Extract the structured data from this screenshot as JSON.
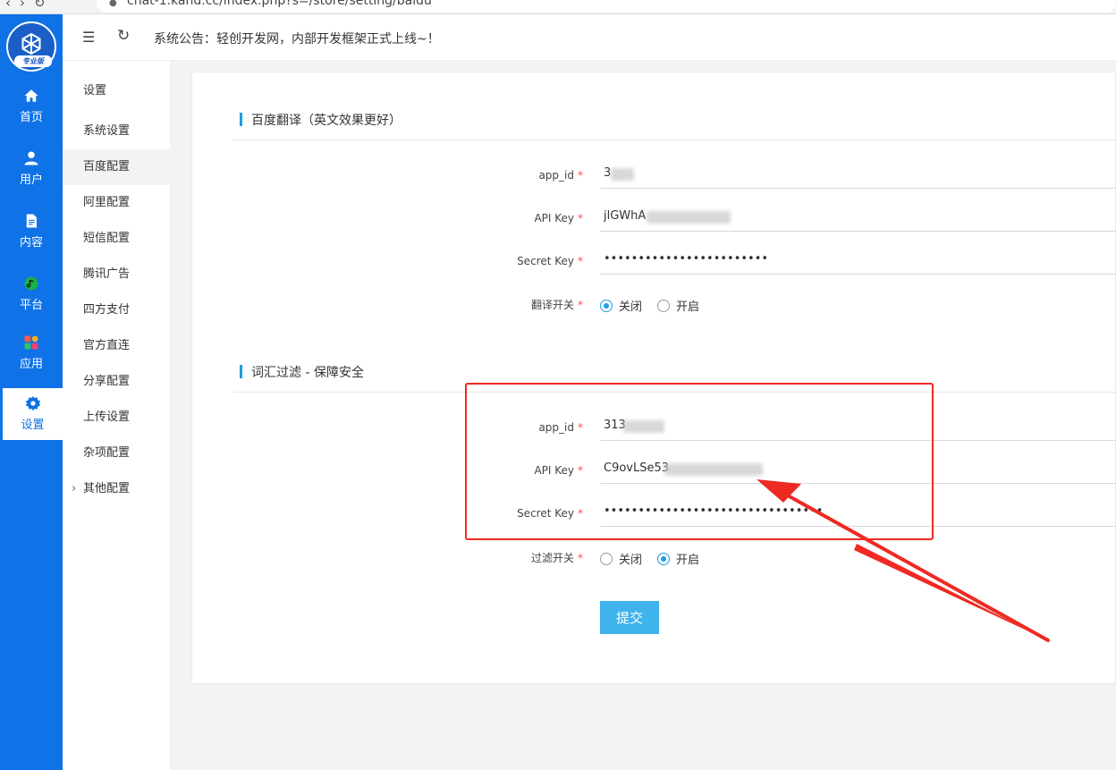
{
  "browser": {
    "url": "chat-1.kand.cc/index.php?s=/store/setting/baidu"
  },
  "sidebar": {
    "logo_badge": "专业版",
    "items": [
      {
        "label": "首页",
        "icon": "home-icon"
      },
      {
        "label": "用户",
        "icon": "user-icon"
      },
      {
        "label": "内容",
        "icon": "document-icon"
      },
      {
        "label": "平台",
        "icon": "platform-icon"
      },
      {
        "label": "应用",
        "icon": "apps-icon"
      },
      {
        "label": "设置",
        "icon": "gear-icon",
        "active": true
      }
    ]
  },
  "topbar": {
    "notice": "系统公告：轻创开发网，内部开发框架正式上线~！"
  },
  "submenu": {
    "title": "设置",
    "items": [
      {
        "label": "系统设置"
      },
      {
        "label": "百度配置",
        "active": true
      },
      {
        "label": "阿里配置"
      },
      {
        "label": "短信配置"
      },
      {
        "label": "腾讯广告"
      },
      {
        "label": "四方支付"
      },
      {
        "label": "官方直连"
      },
      {
        "label": "分享配置"
      },
      {
        "label": "上传设置"
      },
      {
        "label": "杂项配置"
      },
      {
        "label": "其他配置",
        "expandable": true
      }
    ]
  },
  "translate": {
    "section_title": "百度翻译（英文效果更好）",
    "app_id_label": "app_id",
    "app_id_value": "3",
    "api_key_label": "API Key",
    "api_key_value": "jlGWhA",
    "secret_key_label": "Secret Key",
    "secret_key_value": "••••••••••••••••••••••••",
    "switch_label": "翻译开关",
    "option_off": "关闭",
    "option_on": "开启",
    "switch_state": "off"
  },
  "filter": {
    "section_title": "词汇过滤 - 保障安全",
    "app_id_label": "app_id",
    "app_id_value": "313",
    "api_key_label": "API Key",
    "api_key_value": "C9ovLSe53",
    "secret_key_label": "Secret Key",
    "secret_key_value": "••••••••••••••••••••••••••••••••",
    "switch_label": "过滤开关",
    "option_off": "关闭",
    "option_on": "开启",
    "switch_state": "on"
  },
  "form": {
    "submit_label": "提交"
  },
  "colors": {
    "sidebar": "#0f72e6",
    "accent": "#1d9ce5",
    "submit": "#3eb3ec",
    "annotation": "#ee2a22"
  }
}
